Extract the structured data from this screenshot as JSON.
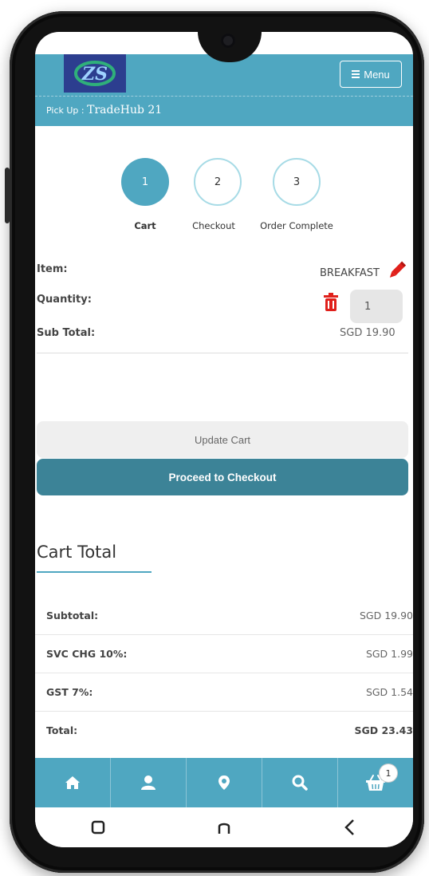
{
  "header": {
    "logo_text": "ZS",
    "menu_label": "Menu",
    "pickup_label": "Pick Up :",
    "pickup_value": "TradeHub 21"
  },
  "steps": [
    {
      "number": "1",
      "label": "Cart",
      "active": true
    },
    {
      "number": "2",
      "label": "Checkout",
      "active": false
    },
    {
      "number": "3",
      "label": "Order Complete",
      "active": false
    }
  ],
  "item": {
    "item_label": "Item:",
    "item_value": "BREAKFAST",
    "quantity_label": "Quantity:",
    "quantity_value": "1",
    "subtotal_label": "Sub Total:",
    "subtotal_value": "SGD 19.90"
  },
  "buttons": {
    "update_cart": "Update Cart",
    "proceed_checkout": "Proceed to Checkout"
  },
  "cart_total": {
    "title": "Cart Total",
    "rows": [
      {
        "label": "Subtotal:",
        "value": "SGD 19.90"
      },
      {
        "label": "SVC CHG 10%:",
        "value": "SGD 1.99"
      },
      {
        "label": "GST 7%:",
        "value": "SGD 1.54"
      },
      {
        "label": "Total:",
        "value": "SGD 23.43"
      }
    ]
  },
  "bottom_nav": {
    "items": [
      "home-icon",
      "user-icon",
      "location-pin-icon",
      "search-icon",
      "basket-icon"
    ],
    "cart_count": "1"
  },
  "system_nav": [
    "recent-apps-icon",
    "home-icon",
    "back-icon"
  ],
  "colors": {
    "primary": "#4fa7c1",
    "primary_dark": "#3c8397",
    "logo_bg": "#2c3e8f",
    "delete_red": "#e0201b",
    "edit_red": "#e0201b"
  }
}
